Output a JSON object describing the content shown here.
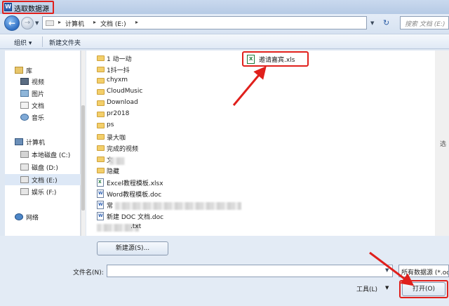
{
  "window": {
    "title": "选取数据源"
  },
  "address": {
    "crumbs": [
      "计算机",
      "文档 (E:)"
    ],
    "search_placeholder": "搜索 文档 (E:)"
  },
  "toolbar": {
    "organize": "组织 ▾",
    "new_folder": "新建文件夹"
  },
  "nav": {
    "library": "库",
    "videos": "视频",
    "pictures": "图片",
    "documents": "文档",
    "music": "音乐",
    "computer": "计算机",
    "drive_c": "本地磁盘 (C:)",
    "drive_d": "磁盘 (D:)",
    "drive_e": "文档 (E:)",
    "drive_f": "娱乐 (F:)",
    "network": "网络"
  },
  "files": {
    "f1": "1 动一动",
    "f2": "1抖一抖",
    "f3": "chyxm",
    "f4": "CloudMusic",
    "f5": "Download",
    "f6": "pr2018",
    "f7": "ps",
    "f8": "录大咖",
    "f9": "完成的视频",
    "f10": "文",
    "f11": "隐藏",
    "f12": "Excel教程模板.xlsx",
    "f13": "Word教程模板.doc",
    "f14": "常",
    "f15": "新建 DOC 文档.doc",
    "f16": ".txt",
    "target": "邀请嘉宾.xls"
  },
  "preview_hint": "选",
  "bottom": {
    "new_source": "新建源(S)...",
    "filename_label": "文件名(N):",
    "filename_value": "",
    "file_type": "所有数据源 (*.od",
    "tools": "工具(L)",
    "open": "打开(O)"
  }
}
